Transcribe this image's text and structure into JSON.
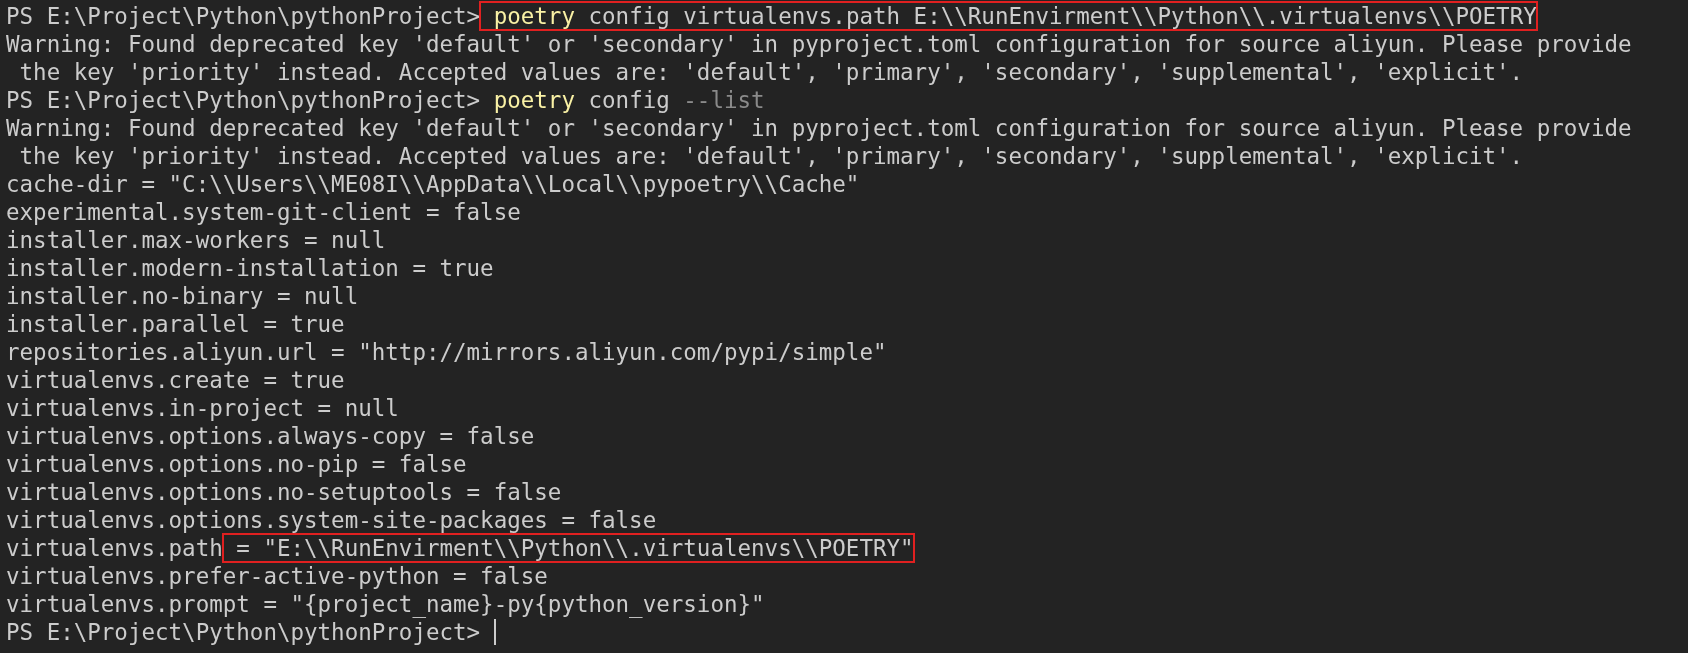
{
  "terminal": {
    "lines": [
      {
        "segments": [
          {
            "kind": "prompt",
            "text": "PS E:\\Project\\Python\\pythonProject>",
            "boxed": false
          },
          {
            "kind": "command",
            "text": " poetry",
            "boxed": true
          },
          {
            "kind": "arg",
            "text": " config virtualenvs.path E:\\\\RunEnvirment\\\\Python\\\\.virtualenvs\\\\POETRY",
            "boxed": true
          }
        ]
      },
      {
        "segments": [
          {
            "kind": "output",
            "text": "Warning: Found deprecated key 'default' or 'secondary' in pyproject.toml configuration for source aliyun. Please provide",
            "boxed": false
          }
        ]
      },
      {
        "segments": [
          {
            "kind": "output",
            "text": " the key 'priority' instead. Accepted values are: 'default', 'primary', 'secondary', 'supplemental', 'explicit'.",
            "boxed": false
          }
        ]
      },
      {
        "segments": [
          {
            "kind": "prompt",
            "text": "PS E:\\Project\\Python\\pythonProject>",
            "boxed": false
          },
          {
            "kind": "command",
            "text": " poetry",
            "boxed": false
          },
          {
            "kind": "arg",
            "text": " config",
            "boxed": false
          },
          {
            "kind": "flag",
            "text": " --list",
            "boxed": false
          }
        ]
      },
      {
        "segments": [
          {
            "kind": "output",
            "text": "Warning: Found deprecated key 'default' or 'secondary' in pyproject.toml configuration for source aliyun. Please provide",
            "boxed": false
          }
        ]
      },
      {
        "segments": [
          {
            "kind": "output",
            "text": " the key 'priority' instead. Accepted values are: 'default', 'primary', 'secondary', 'supplemental', 'explicit'.",
            "boxed": false
          }
        ]
      },
      {
        "segments": [
          {
            "kind": "output",
            "text": "cache-dir = \"C:\\\\Users\\\\ME08I\\\\AppData\\\\Local\\\\pypoetry\\\\Cache\"",
            "boxed": false
          }
        ]
      },
      {
        "segments": [
          {
            "kind": "output",
            "text": "experimental.system-git-client = false",
            "boxed": false
          }
        ]
      },
      {
        "segments": [
          {
            "kind": "output",
            "text": "installer.max-workers = null",
            "boxed": false
          }
        ]
      },
      {
        "segments": [
          {
            "kind": "output",
            "text": "installer.modern-installation = true",
            "boxed": false
          }
        ]
      },
      {
        "segments": [
          {
            "kind": "output",
            "text": "installer.no-binary = null",
            "boxed": false
          }
        ]
      },
      {
        "segments": [
          {
            "kind": "output",
            "text": "installer.parallel = true",
            "boxed": false
          }
        ]
      },
      {
        "segments": [
          {
            "kind": "output",
            "text": "repositories.aliyun.url = \"http://mirrors.aliyun.com/pypi/simple\"",
            "boxed": false
          }
        ]
      },
      {
        "segments": [
          {
            "kind": "output",
            "text": "virtualenvs.create = true",
            "boxed": false
          }
        ]
      },
      {
        "segments": [
          {
            "kind": "output",
            "text": "virtualenvs.in-project = null",
            "boxed": false
          }
        ]
      },
      {
        "segments": [
          {
            "kind": "output",
            "text": "virtualenvs.options.always-copy = false",
            "boxed": false
          }
        ]
      },
      {
        "segments": [
          {
            "kind": "output",
            "text": "virtualenvs.options.no-pip = false",
            "boxed": false
          }
        ]
      },
      {
        "segments": [
          {
            "kind": "output",
            "text": "virtualenvs.options.no-setuptools = false",
            "boxed": false
          }
        ]
      },
      {
        "segments": [
          {
            "kind": "output",
            "text": "virtualenvs.options.system-site-packages = false",
            "boxed": false
          }
        ]
      },
      {
        "segments": [
          {
            "kind": "output",
            "text": "virtualenvs.path",
            "boxed": false
          },
          {
            "kind": "output",
            "text": " = \"E:\\\\RunEnvirment\\\\Python\\\\.virtualenvs\\\\POETRY\"",
            "boxed": true
          }
        ]
      },
      {
        "segments": [
          {
            "kind": "output",
            "text": "virtualenvs.prefer-active-python = false",
            "boxed": false
          }
        ]
      },
      {
        "segments": [
          {
            "kind": "output",
            "text": "virtualenvs.prompt = \"{project_name}-py{python_version}\"",
            "boxed": false
          }
        ]
      },
      {
        "segments": [
          {
            "kind": "prompt",
            "text": "PS E:\\Project\\Python\\pythonProject>",
            "boxed": false
          }
        ]
      }
    ]
  }
}
